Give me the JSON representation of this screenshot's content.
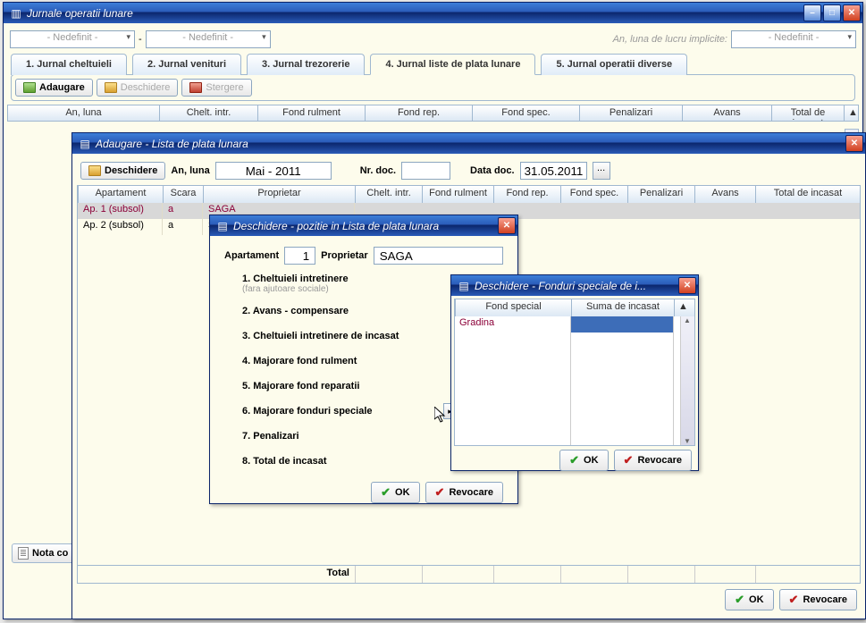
{
  "mainWindow": {
    "title": "Jurnale operatii lunare",
    "combo1": "- Nedefinit -",
    "dash": "-",
    "combo2": "- Nedefinit -",
    "hint": "An, luna de lucru implicite:",
    "combo3": "- Nedefinit -",
    "tabs": {
      "t1": "1. Jurnal cheltuieli",
      "t2": "2. Jurnal venituri",
      "t3": "3. Jurnal trezorerie",
      "t4": "4. Jurnal liste de plata lunare",
      "t5": "5. Jurnal operatii diverse"
    },
    "subbar": {
      "add": "Adaugare",
      "open": "Deschidere",
      "del": "Stergere"
    },
    "cols": {
      "c1": "An, luna",
      "c2": "Chelt. intr.",
      "c3": "Fond rulment",
      "c4": "Fond rep.",
      "c5": "Fond spec.",
      "c6": "Penalizari",
      "c7": "Avans",
      "c8": "Total de incasat"
    },
    "note": "Nota co"
  },
  "addWindow": {
    "title": "Adaugare - Lista de plata lunara",
    "open": "Deschidere",
    "anluna_lbl": "An, luna",
    "anluna_val": "Mai - 2011",
    "nrdoc_lbl": "Nr. doc.",
    "nrdoc_val": "",
    "datadoc_lbl": "Data doc.",
    "datadoc_val": "31.05.2011",
    "cols": {
      "c1": "Apartament",
      "c2": "Scara",
      "c3": "Proprietar",
      "c4": "Chelt. intr.",
      "c5": "Fond rulment",
      "c6": "Fond rep.",
      "c7": "Fond spec.",
      "c8": "Penalizari",
      "c9": "Avans",
      "c10": "Total de incasat"
    },
    "rows": [
      {
        "ap": "Ap. 1 (subsol)",
        "sc": "a",
        "prop": "SAGA"
      },
      {
        "ap": "Ap. 2 (subsol)",
        "sc": "a",
        "prop": "S"
      }
    ],
    "total": "Total",
    "ok": "OK",
    "cancel": "Revocare"
  },
  "posWindow": {
    "title": "Deschidere - pozitie in Lista de plata lunara",
    "ap_lbl": "Apartament",
    "ap_val": "1",
    "prop_lbl": "Proprietar",
    "prop_val": "SAGA",
    "items": {
      "i1": "1. Cheltuieli intretinere",
      "i1s": "(fara ajutoare sociale)",
      "i2": "2. Avans - compensare",
      "i3": "3. Cheltuieli intretinere de incasat",
      "i4": "4. Majorare fond rulment",
      "i5": "5. Majorare fond reparatii",
      "i6": "6. Majorare fonduri speciale",
      "i7": "7. Penalizari",
      "i8": "8. Total de incasat"
    },
    "ok": "OK",
    "cancel": "Revocare"
  },
  "fundWindow": {
    "title": "Deschidere - Fonduri speciale de i...",
    "cols": {
      "c1": "Fond special",
      "c2": "Suma de incasat"
    },
    "rows": [
      {
        "name": "Gradina",
        "sum": ""
      }
    ],
    "ok": "OK",
    "cancel": "Revocare"
  }
}
